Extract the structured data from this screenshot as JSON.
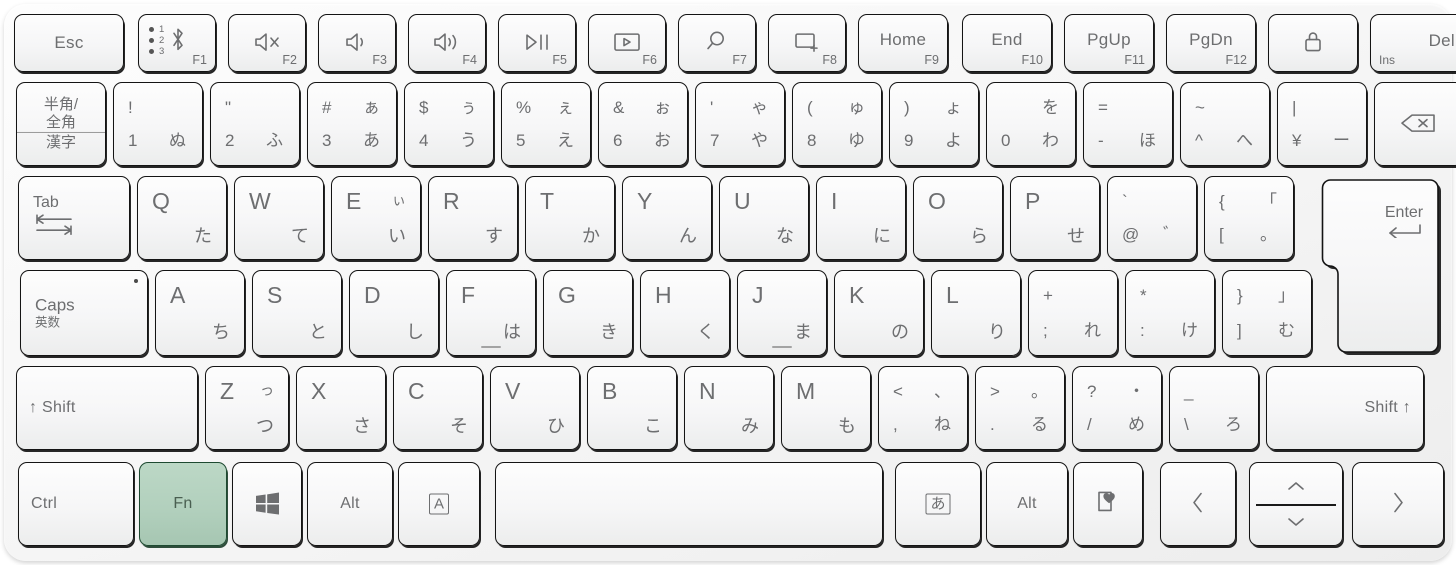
{
  "device": {
    "name": "japanese-jis-bluetooth-keyboard",
    "highlight_color": "#b2d0bd",
    "highlight_border": "#1e4a31",
    "key_face_color": "#f6f6f7",
    "legend_color": "#6d6e70",
    "body_color": "#f7f7f7"
  },
  "highlighted_key": "Fn",
  "rows": {
    "function_row": [
      {
        "id": "esc",
        "label": "Esc"
      },
      {
        "id": "bluetooth-pair",
        "icon": "bluetooth-icon",
        "fn": "F1",
        "indicators": [
          "1",
          "2",
          "3"
        ]
      },
      {
        "id": "mute",
        "icon": "speaker-mute-icon",
        "fn": "F2"
      },
      {
        "id": "volume-down",
        "icon": "speaker-low-icon",
        "fn": "F3"
      },
      {
        "id": "volume-up",
        "icon": "speaker-high-icon",
        "fn": "F4"
      },
      {
        "id": "play-pause",
        "icon": "play-pause-icon",
        "fn": "F5"
      },
      {
        "id": "project",
        "icon": "screen-play-icon",
        "fn": "F6"
      },
      {
        "id": "search",
        "icon": "magnifier-icon",
        "fn": "F7"
      },
      {
        "id": "new-window",
        "icon": "new-window-icon",
        "fn": "F8"
      },
      {
        "id": "home",
        "label": "Home",
        "fn": "F9"
      },
      {
        "id": "end",
        "label": "End",
        "fn": "F10"
      },
      {
        "id": "page-up",
        "label": "PgUp",
        "fn": "F11"
      },
      {
        "id": "page-down",
        "label": "PgDn",
        "fn": "F12"
      },
      {
        "id": "lock",
        "icon": "padlock-icon"
      },
      {
        "id": "delete",
        "label": "Del",
        "alt": "Ins"
      }
    ],
    "number_row": [
      {
        "id": "hankaku-zenkaku",
        "lines": [
          "半角/",
          "全角",
          "漢字"
        ]
      },
      {
        "id": "digit-1",
        "shift": "!",
        "base": "1",
        "kana": "ぬ"
      },
      {
        "id": "digit-2",
        "shift": "\"",
        "base": "2",
        "kana": "ふ"
      },
      {
        "id": "digit-3",
        "shift": "#",
        "base": "3",
        "kana_shift": "ぁ",
        "kana": "あ"
      },
      {
        "id": "digit-4",
        "shift": "$",
        "base": "4",
        "kana_shift": "ぅ",
        "kana": "う"
      },
      {
        "id": "digit-5",
        "shift": "%",
        "base": "5",
        "kana_shift": "ぇ",
        "kana": "え"
      },
      {
        "id": "digit-6",
        "shift": "&",
        "base": "6",
        "kana_shift": "ぉ",
        "kana": "お"
      },
      {
        "id": "digit-7",
        "shift": "'",
        "base": "7",
        "kana_shift": "ゃ",
        "kana": "や"
      },
      {
        "id": "digit-8",
        "shift": "(",
        "base": "8",
        "kana_shift": "ゅ",
        "kana": "ゆ"
      },
      {
        "id": "digit-9",
        "shift": ")",
        "base": "9",
        "kana_shift": "ょ",
        "kana": "よ"
      },
      {
        "id": "digit-0",
        "shift": "",
        "base": "0",
        "kana_shift": "を",
        "kana": "わ"
      },
      {
        "id": "minus",
        "shift": "=",
        "base": "-",
        "kana": "ほ"
      },
      {
        "id": "caret",
        "shift": "~",
        "base": "^",
        "kana": "へ"
      },
      {
        "id": "yen",
        "shift": "|",
        "base": "¥",
        "kana": "ー"
      },
      {
        "id": "backspace",
        "icon": "backspace-icon"
      }
    ],
    "top_row": [
      {
        "id": "tab",
        "label": "Tab",
        "icon": "tab-arrows-icon"
      },
      {
        "id": "key-q",
        "alpha": "Q",
        "kana": "た"
      },
      {
        "id": "key-w",
        "alpha": "W",
        "kana": "て"
      },
      {
        "id": "key-e",
        "alpha": "E",
        "kana_shift": "ぃ",
        "kana": "い"
      },
      {
        "id": "key-r",
        "alpha": "R",
        "kana": "す"
      },
      {
        "id": "key-t",
        "alpha": "T",
        "kana": "か"
      },
      {
        "id": "key-y",
        "alpha": "Y",
        "kana": "ん"
      },
      {
        "id": "key-u",
        "alpha": "U",
        "kana": "な"
      },
      {
        "id": "key-i",
        "alpha": "I",
        "kana": "に"
      },
      {
        "id": "key-o",
        "alpha": "O",
        "kana": "ら"
      },
      {
        "id": "key-p",
        "alpha": "P",
        "kana": "せ"
      },
      {
        "id": "at",
        "shift": "`",
        "base": "@",
        "kana": "゛"
      },
      {
        "id": "bracket-left",
        "shift": "{",
        "base": "[",
        "kana_shift": "「",
        "kana": "。"
      },
      {
        "id": "enter",
        "label": "Enter",
        "icon": "enter-arrow-icon"
      }
    ],
    "home_row": [
      {
        "id": "caps-lock",
        "label": "Caps",
        "sub": "英数",
        "has_led": true
      },
      {
        "id": "key-a",
        "alpha": "A",
        "kana": "ち"
      },
      {
        "id": "key-s",
        "alpha": "S",
        "kana": "と"
      },
      {
        "id": "key-d",
        "alpha": "D",
        "kana": "し"
      },
      {
        "id": "key-f",
        "alpha": "F",
        "kana": "は",
        "homing": true
      },
      {
        "id": "key-g",
        "alpha": "G",
        "kana": "き"
      },
      {
        "id": "key-h",
        "alpha": "H",
        "kana": "く"
      },
      {
        "id": "key-j",
        "alpha": "J",
        "kana": "ま",
        "homing": true
      },
      {
        "id": "key-k",
        "alpha": "K",
        "kana": "の"
      },
      {
        "id": "key-l",
        "alpha": "L",
        "kana": "り"
      },
      {
        "id": "semicolon",
        "shift": "+",
        "base": ";",
        "kana": "れ"
      },
      {
        "id": "colon",
        "shift": "*",
        "base": ":",
        "kana": "け"
      },
      {
        "id": "bracket-right",
        "shift": "}",
        "base": "]",
        "kana_shift": "」",
        "kana": "む"
      }
    ],
    "bottom_letter_row": [
      {
        "id": "shift-left",
        "label": "↑ Shift"
      },
      {
        "id": "key-z",
        "alpha": "Z",
        "kana_shift": "っ",
        "kana": "つ"
      },
      {
        "id": "key-x",
        "alpha": "X",
        "kana": "さ"
      },
      {
        "id": "key-c",
        "alpha": "C",
        "kana": "そ"
      },
      {
        "id": "key-v",
        "alpha": "V",
        "kana": "ひ"
      },
      {
        "id": "key-b",
        "alpha": "B",
        "kana": "こ"
      },
      {
        "id": "key-n",
        "alpha": "N",
        "kana": "み"
      },
      {
        "id": "key-m",
        "alpha": "M",
        "kana": "も"
      },
      {
        "id": "comma",
        "shift": "<",
        "base": ",",
        "kana_shift": "、",
        "kana": "ね"
      },
      {
        "id": "period",
        "shift": ">",
        "base": ".",
        "kana_shift": "。",
        "kana": "る"
      },
      {
        "id": "slash",
        "shift": "?",
        "base": "/",
        "kana_shift": "・",
        "kana": "め"
      },
      {
        "id": "backslash",
        "shift": "_",
        "base": "\\",
        "kana": "ろ"
      },
      {
        "id": "shift-right",
        "label": "Shift ↑"
      }
    ],
    "modifier_row": [
      {
        "id": "ctrl",
        "label": "Ctrl"
      },
      {
        "id": "fn",
        "label": "Fn",
        "highlighted": true
      },
      {
        "id": "windows",
        "icon": "windows-icon"
      },
      {
        "id": "alt-left",
        "label": "Alt"
      },
      {
        "id": "muhenkan",
        "boxed": "A"
      },
      {
        "id": "space",
        "label": ""
      },
      {
        "id": "henkan",
        "boxed": "あ"
      },
      {
        "id": "alt-right",
        "label": "Alt"
      },
      {
        "id": "emoji",
        "icon": "emoji-heart-icon"
      },
      {
        "id": "arrow-left",
        "icon": "chevron-left-icon"
      },
      {
        "id": "arrow-up-down",
        "icon_up": "chevron-up-icon",
        "icon_down": "chevron-down-icon"
      },
      {
        "id": "arrow-right",
        "icon": "chevron-right-icon"
      }
    ]
  }
}
